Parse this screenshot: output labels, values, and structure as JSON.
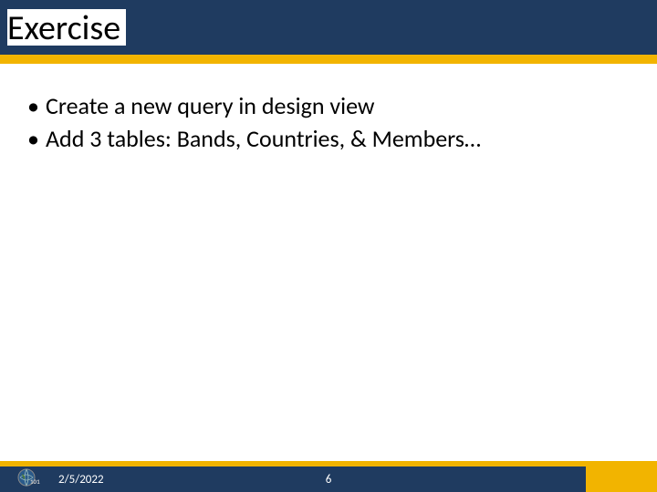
{
  "slide": {
    "title": "Exercise",
    "bullets": [
      "Create a new query in design view",
      "Add 3 tables: Bands, Countries, & Members…"
    ]
  },
  "footer": {
    "date": "2/5/2022",
    "page_number": "6"
  },
  "colors": {
    "header_bg": "#1f3b60",
    "accent": "#f2b400"
  }
}
